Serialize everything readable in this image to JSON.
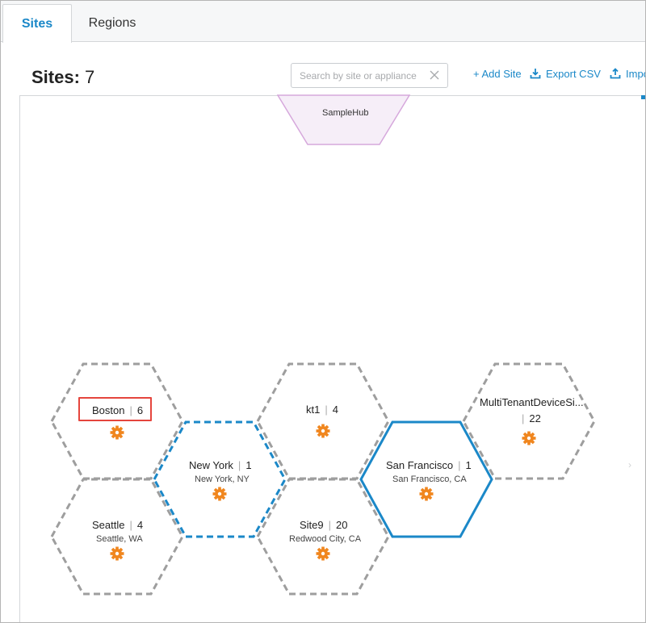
{
  "tabs": [
    {
      "label": "Sites",
      "active": true
    },
    {
      "label": "Regions",
      "active": false
    }
  ],
  "header": {
    "title": "Sites:",
    "count": "7"
  },
  "search": {
    "placeholder": "Search by site or appliance",
    "value": ""
  },
  "actions": {
    "add_site": "+ Add Site",
    "export_csv": "Export CSV",
    "import": "Impo"
  },
  "hub": {
    "name": "SampleHub"
  },
  "sites": [
    {
      "name": "Boston",
      "count": "6",
      "location": "",
      "selected": true,
      "style": "dashed-gray"
    },
    {
      "name": "kt1",
      "count": "4",
      "location": "",
      "style": "dashed-gray"
    },
    {
      "name": "MultiTenantDeviceSi...",
      "count": "22",
      "location": "",
      "style": "dashed-gray"
    },
    {
      "name": "New York",
      "count": "1",
      "location": "New York, NY",
      "style": "dashed-blue"
    },
    {
      "name": "San Francisco",
      "count": "1",
      "location": "San Francisco, CA",
      "style": "solid-blue"
    },
    {
      "name": "Seattle",
      "count": "4",
      "location": "Seattle, WA",
      "style": "dashed-gray"
    },
    {
      "name": "Site9",
      "count": "20",
      "location": "Redwood City, CA",
      "style": "dashed-gray"
    }
  ],
  "colors": {
    "accent": "#1b88c8",
    "gear": "#f0861e",
    "selected_border": "#e5453d",
    "hex_gray": "#9e9e9e",
    "hub_fill": "#f6eef8",
    "hub_border": "#d6a8dc"
  },
  "icons": [
    "close-icon",
    "download-icon",
    "upload-icon",
    "gear-icon"
  ]
}
